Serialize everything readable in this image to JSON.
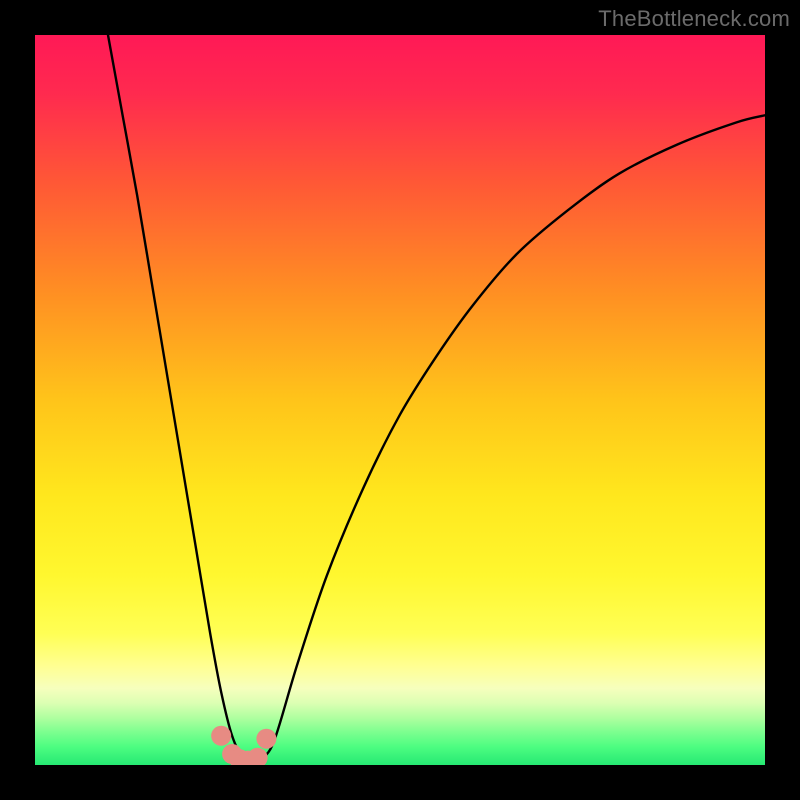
{
  "watermark": "TheBottleneck.com",
  "colors": {
    "frame": "#000000",
    "curve": "#000000",
    "marker_fill": "#e78b83",
    "marker_stroke": "#d66e64",
    "gradient_stops": [
      {
        "offset": 0.0,
        "color": "#ff1956"
      },
      {
        "offset": 0.08,
        "color": "#ff2a4f"
      },
      {
        "offset": 0.2,
        "color": "#ff5736"
      },
      {
        "offset": 0.35,
        "color": "#ff8e23"
      },
      {
        "offset": 0.5,
        "color": "#ffc41a"
      },
      {
        "offset": 0.63,
        "color": "#ffe71d"
      },
      {
        "offset": 0.74,
        "color": "#fff72f"
      },
      {
        "offset": 0.82,
        "color": "#ffff55"
      },
      {
        "offset": 0.865,
        "color": "#ffff93"
      },
      {
        "offset": 0.895,
        "color": "#f6ffbd"
      },
      {
        "offset": 0.915,
        "color": "#dcffb3"
      },
      {
        "offset": 0.935,
        "color": "#b0ffa0"
      },
      {
        "offset": 0.955,
        "color": "#7cff8f"
      },
      {
        "offset": 0.975,
        "color": "#4dfd81"
      },
      {
        "offset": 1.0,
        "color": "#26e973"
      }
    ]
  },
  "chart_data": {
    "type": "line",
    "title": "",
    "xlabel": "",
    "ylabel": "",
    "xlim": [
      0,
      100
    ],
    "ylim": [
      0,
      100
    ],
    "note": "Values are estimated from pixel positions; origin at bottom-left of the colored plot area. The curve dips to y≈0 near x≈28 and rises steeply on both sides.",
    "series": [
      {
        "name": "curve",
        "x": [
          10,
          12,
          14,
          16,
          18,
          20,
          22,
          24,
          25.5,
          27,
          28.5,
          30,
          31.5,
          33,
          36,
          40,
          45,
          50,
          55,
          60,
          66,
          73,
          80,
          88,
          96,
          100
        ],
        "y": [
          100,
          89,
          78,
          66,
          54,
          42,
          30,
          18,
          10,
          4,
          1.0,
          0.6,
          1.2,
          4,
          14,
          26,
          38,
          48,
          56,
          63,
          70,
          76,
          81,
          85,
          88,
          89
        ]
      }
    ],
    "markers": {
      "name": "highlighted-points",
      "x": [
        25.5,
        27.0,
        28.0,
        29.2,
        30.5,
        31.7
      ],
      "y": [
        4.0,
        1.5,
        0.8,
        0.6,
        1.0,
        3.6
      ]
    }
  }
}
